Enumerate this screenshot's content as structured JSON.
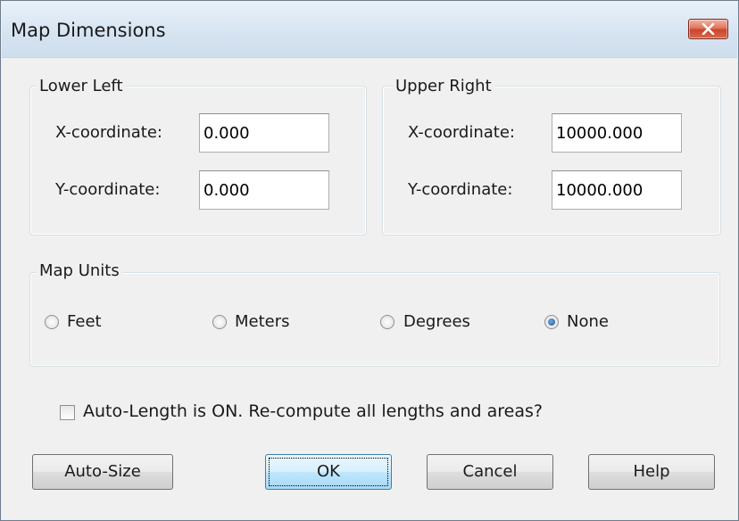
{
  "window": {
    "title": "Map Dimensions"
  },
  "lower_left": {
    "legend": "Lower Left",
    "x_label": "X-coordinate:",
    "x_value": "0.000",
    "y_label": "Y-coordinate:",
    "y_value": "0.000"
  },
  "upper_right": {
    "legend": "Upper Right",
    "x_label": "X-coordinate:",
    "x_value": "10000.000",
    "y_label": "Y-coordinate:",
    "y_value": "10000.000"
  },
  "map_units": {
    "legend": "Map Units",
    "options": [
      {
        "label": "Feet",
        "checked": false
      },
      {
        "label": "Meters",
        "checked": false
      },
      {
        "label": "Degrees",
        "checked": false
      },
      {
        "label": "None",
        "checked": true
      }
    ]
  },
  "auto_length": {
    "label": "Auto-Length is ON. Re-compute all lengths and areas?",
    "checked": false
  },
  "buttons": {
    "auto_size": "Auto-Size",
    "ok": "OK",
    "cancel": "Cancel",
    "help": "Help"
  }
}
